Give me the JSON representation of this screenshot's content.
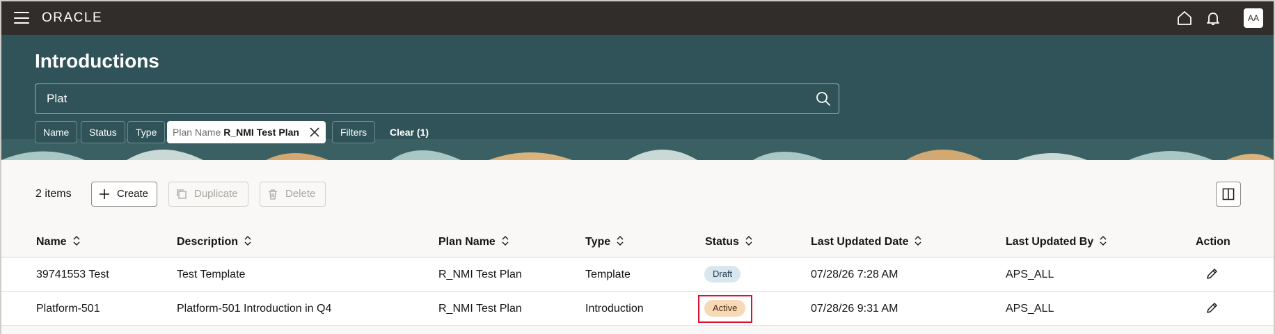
{
  "app": {
    "logo": "ORACLE",
    "avatar_initials": "AA"
  },
  "page": {
    "title": "Introductions"
  },
  "search": {
    "value": "Plat"
  },
  "filters": {
    "chips": [
      "Name",
      "Status",
      "Type"
    ],
    "active_chip": {
      "key": "Plan Name",
      "value": "R_NMI Test Plan"
    },
    "filters_label": "Filters",
    "clear_label": "Clear (1)"
  },
  "toolbar": {
    "count": "2 items",
    "create": "Create",
    "duplicate": "Duplicate",
    "delete": "Delete"
  },
  "table": {
    "columns": [
      "Name",
      "Description",
      "Plan Name",
      "Type",
      "Status",
      "Last Updated Date",
      "Last Updated By",
      "Action"
    ],
    "rows": [
      {
        "name": "39741553 Test",
        "description": "Test Template",
        "plan_name": "R_NMI Test Plan",
        "type": "Template",
        "status": "Draft",
        "updated_date": "07/28/26 7:28 AM",
        "updated_by": "APS_ALL"
      },
      {
        "name": "Platform-501",
        "description": "Platform-501 Introduction in Q4",
        "plan_name": "R_NMI Test Plan",
        "type": "Introduction",
        "status": "Active",
        "updated_date": "07/28/26 9:31 AM",
        "updated_by": "APS_ALL"
      }
    ]
  },
  "colors": {
    "topbar": "#312d2a",
    "header": "#2f5358",
    "draft_badge": "#d9e6ee",
    "active_badge": "#f7d9b7",
    "highlight": "#e0102b"
  }
}
